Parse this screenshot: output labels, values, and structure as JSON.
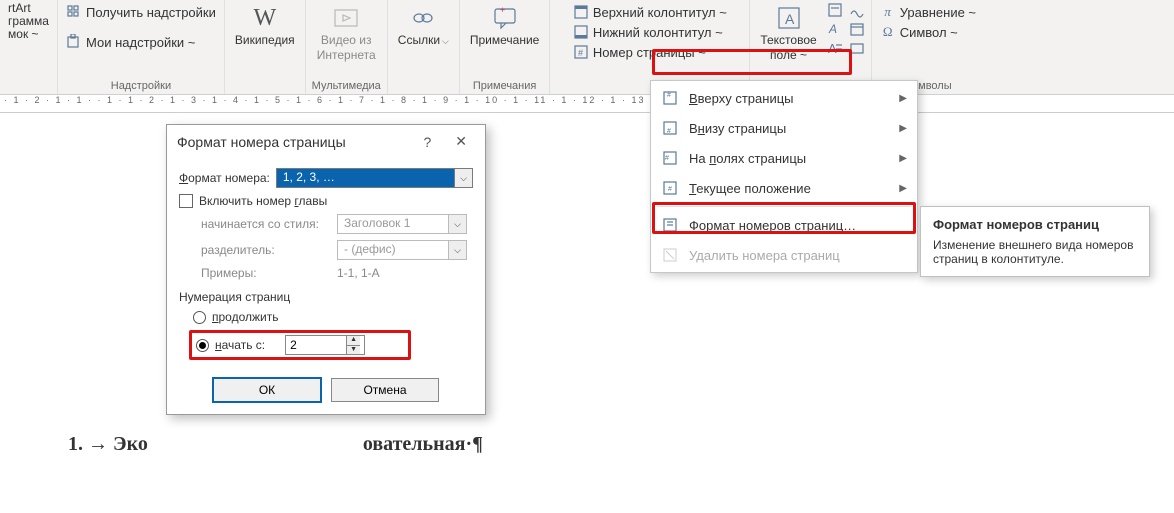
{
  "ribbon": {
    "group_smartart": {
      "l1": "rtArt",
      "l2": "грамма",
      "l3": "мок ~"
    },
    "group_addins": {
      "get": "Получить надстройки",
      "my": "Мои надстройки ~",
      "label": "Надстройки"
    },
    "group_wiki": {
      "label": "Википедия"
    },
    "group_media": {
      "video_l1": "Видео из",
      "video_l2": "Интернета",
      "label": "Мультимедиа"
    },
    "group_links": {
      "label": "Ссылки"
    },
    "group_comment": {
      "btn": "Примечание",
      "label": "Примечания"
    },
    "group_hf": {
      "header": "Верхний колонтитул ~",
      "footer": "Нижний колонтитул ~",
      "pagenum": "Номер страницы ~"
    },
    "group_text": {
      "btn_l1": "Текстовое",
      "btn_l2": "поле ~",
      "label": "Текст"
    },
    "group_symbols": {
      "eq": "Уравнение ~",
      "sym": "Символ ~",
      "label": "Символы"
    }
  },
  "ruler": "· 1 · 2 · 1 · 1 ·   · 1 · 1 · 2 · 1 · 3 · 1 · 4 · 1 · 5 · 1 · 6 · 1 · 7 · 1 · 8 · 1 · 9 · 1 · 10 · 1 · 11 · 1 · 12 · 1 · 13 · 1 · 14 · 1 · 15 · 1 · 16 ·   · 17 · 1 ·",
  "menu": {
    "top": "Вверху страницы",
    "bottom": "Внизу страницы",
    "margins": "На полях страницы",
    "current": "Текущее положение",
    "format": "Формат номеров страниц…",
    "remove": "Удалить номера страниц"
  },
  "dialog": {
    "title": "Формат номера страницы",
    "format_label": "Формат номера:",
    "format_value": "1, 2, 3, …",
    "include_chapter": "Включить номер главы",
    "starts_style": "начинается со стиля:",
    "starts_style_value": "Заголовок 1",
    "separator": "разделитель:",
    "separator_value": "-   (дефис)",
    "examples": "Примеры:",
    "examples_value": "1-1, 1-А",
    "numbering": "Нумерация страниц",
    "continue": "продолжить",
    "start_at": "начать с:",
    "start_value": "2",
    "ok": "ОК",
    "cancel": "Отмена"
  },
  "tooltip": {
    "title": "Формат номеров страниц",
    "body": "Изменение внешнего вида номеров страниц в колонтитуле."
  },
  "doc": {
    "line": "1. → Эко                                           овательная·¶"
  }
}
